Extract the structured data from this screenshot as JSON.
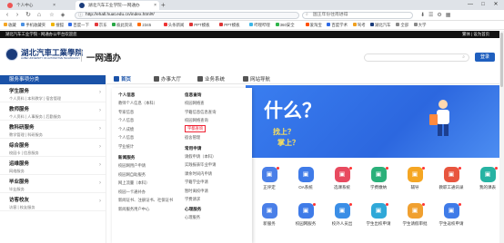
{
  "browser": {
    "tab1": "个人中心",
    "tab2": "湖北汽车工业学院-一网通办",
    "new_tab": "+",
    "minimize": "—",
    "maximize": "□",
    "close": "✕",
    "back": "‹",
    "forward": "›",
    "reload": "↻",
    "home": "⌂",
    "url": "http://ehall.huat.edu.cn/index.html#/",
    "search_placeholder": "国王年份往南进得",
    "bookmarks": [
      {
        "label": "收藏",
        "color": "#f5a623"
      },
      {
        "label": "手机收藏夹",
        "color": "#4a90e2"
      },
      {
        "label": "搜狐",
        "color": "#f0b400"
      },
      {
        "label": "百度一下",
        "color": "#2f6be6"
      },
      {
        "label": "京东",
        "color": "#e4393c"
      },
      {
        "label": "彼此资讯",
        "color": "#28a745"
      },
      {
        "label": "2345",
        "color": "#ff6b00"
      },
      {
        "label": "头条新闻",
        "color": "#e33"
      },
      {
        "label": "PPT模板",
        "color": "#d33"
      },
      {
        "label": "PPT模板",
        "color": "#d33"
      },
      {
        "label": "哔哩哔哩",
        "color": "#3ab6e8"
      },
      {
        "label": "360安全",
        "color": "#30b54b"
      },
      {
        "label": "爱淘宝",
        "color": "#ff5000"
      },
      {
        "label": "百度学术",
        "color": "#2f6be6"
      },
      {
        "label": "驾考",
        "color": "#f0a020"
      },
      {
        "label": "湖北汽车",
        "color": "#1a3b7a"
      },
      {
        "label": "全部",
        "color": "#888"
      },
      {
        "label": "大学",
        "color": "#888"
      }
    ]
  },
  "topstrip": {
    "left": "湖北汽车工业学院 - 网通办公平台欢迎您",
    "right": "繁体 | 设为首页"
  },
  "header": {
    "logo_cn": "湖北汽車工業學院",
    "logo_en": "HUBEI UNIVERSITY OF AUTOMOTIVE TECHNOLOGY",
    "brand": "一网通办",
    "search_icon": "search-icon",
    "login": "登录"
  },
  "sidebar": {
    "title": "服务事项分类",
    "categories": [
      {
        "title": "学生服务",
        "sub": "个人资料 | 本科教学 | 宿舍管理"
      },
      {
        "title": "教师服务",
        "sub": "个人资料 | 人事服务 | 后勤服务"
      },
      {
        "title": "教科研服务",
        "sub": "教学管理 | 科研服务"
      },
      {
        "title": "综合服务",
        "sub": "校园卡 | 信息服务"
      },
      {
        "title": "运维服务",
        "sub": "网络服务"
      },
      {
        "title": "毕业服务",
        "sub": "毕业服务"
      },
      {
        "title": "访客校友",
        "sub": "访客 | 校友服务"
      }
    ]
  },
  "mainnav": {
    "items": [
      "首页",
      "办事大厅",
      "业务系统",
      "网站导航"
    ]
  },
  "mega": {
    "col1_title": "个人信息",
    "col1_items": [
      "教师个人信息（本科）",
      "专家信息",
      "个人信息",
      "个人成绩",
      "个人信息",
      "学业统计"
    ],
    "col1b_title": "新闻服务",
    "col1b_items": [
      "校园网用户申请",
      "校园网自助服务",
      "网上流量（本科）",
      "校园一卡通补办",
      "新闻证书、注册证书、社保证书",
      "新闻服务用户中心"
    ],
    "col2_title": "信息查询",
    "col2_items": [
      "校园网络查",
      "学籍信息信息查询",
      "校园网络查询"
    ],
    "col2_highlight": "宇都查询",
    "col2_tail": [
      "宿舍管理"
    ],
    "col2b_title": "常用申请",
    "col2b_items": [
      "请假申请（本科）",
      "实践报表毕业申请",
      "课余时间内申请",
      "学籍学业申请",
      "暂时离校申请",
      "学费请求"
    ],
    "col2c_title": "心理服务",
    "col2c_items": [
      "心理服务"
    ]
  },
  "banner": {
    "headline": "什么？",
    "line1": "找上？",
    "line2": "掌上？"
  },
  "services": [
    {
      "label": "正评定",
      "color": "#4a7fe8",
      "dot": true
    },
    {
      "label": "OA系统",
      "color": "#3f7be8",
      "dot": false
    },
    {
      "label": "选课系统",
      "color": "#e84a5f",
      "dot": true
    },
    {
      "label": "学费缴纳",
      "color": "#2bb07a",
      "dot": true
    },
    {
      "label": "辅导",
      "color": "#f5a623",
      "dot": true
    },
    {
      "label": "教职工通讯录",
      "color": "#e8553e",
      "dot": true
    },
    {
      "label": "我的课表",
      "color": "#27b3a3",
      "dot": true
    },
    {
      "label": "新服务",
      "color": "#4a7fe8",
      "dot": false
    },
    {
      "label": "校园网服务",
      "color": "#3f7be8",
      "dot": true
    },
    {
      "label": "校外人员出",
      "color": "#3a8ee6",
      "dot": true
    },
    {
      "label": "学生出校申请",
      "color": "#2fa8d8",
      "dot": true
    },
    {
      "label": "学生请假审批",
      "color": "#f0a030",
      "dot": true
    },
    {
      "label": "学生返校申请",
      "color": "#3f7be8",
      "dot": true
    }
  ]
}
